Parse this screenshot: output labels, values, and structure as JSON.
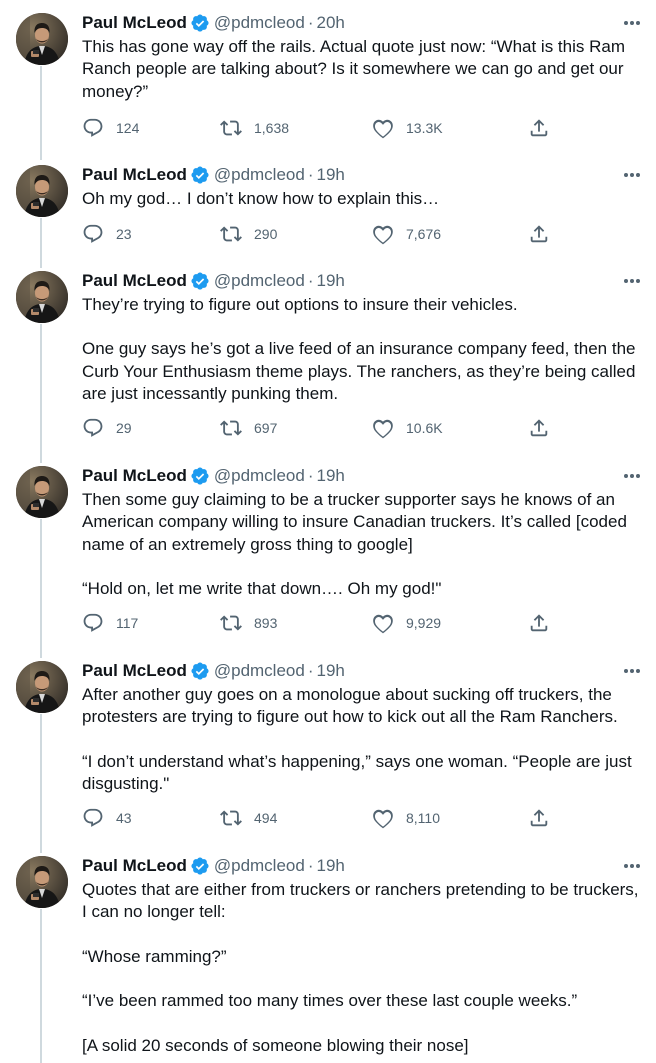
{
  "author": {
    "name": "Paul McLeod",
    "handle": "@pdmcleod",
    "verified": true
  },
  "colors": {
    "text": "#0f1419",
    "secondary": "#536471",
    "verified_badge": "#1d9bf0",
    "thread_line": "#cfd9de"
  },
  "icons": {
    "reply": "speech-bubble",
    "retweet": "two-arrows-loop",
    "like": "heart",
    "share": "upload-arrow",
    "more": "three-dots"
  },
  "tweets": [
    {
      "time": "20h",
      "paragraphs": [
        "This has gone way off the rails. Actual quote just now: “What is this Ram Ranch people are talking about? Is it somewhere we can go and get our money?”"
      ],
      "replies": "124",
      "retweets": "1,638",
      "likes": "13.3K"
    },
    {
      "time": "19h",
      "paragraphs": [
        "Oh my god… I don’t know how to explain this…"
      ],
      "replies": "23",
      "retweets": "290",
      "likes": "7,676"
    },
    {
      "time": "19h",
      "paragraphs": [
        "They’re trying to figure out options to insure their vehicles.",
        "One guy says he’s got a live feed of an insurance company feed, then the Curb Your Enthusiasm theme plays. The ranchers, as they’re being called are just incessantly punking them."
      ],
      "replies": "29",
      "retweets": "697",
      "likes": "10.6K"
    },
    {
      "time": "19h",
      "paragraphs": [
        "Then some guy claiming to be a trucker supporter says he knows of an American company willing to insure Canadian truckers. It’s called [coded name of an extremely gross thing to google]",
        "“Hold on, let me write that down…. Oh my god!\""
      ],
      "replies": "117",
      "retweets": "893",
      "likes": "9,929"
    },
    {
      "time": "19h",
      "paragraphs": [
        "After another guy goes on a monologue about sucking off truckers, the protesters are trying to figure out how to kick out all the Ram Ranchers.",
        "“I don’t understand what’s happening,” says one woman. “People are just disgusting.\""
      ],
      "replies": "43",
      "retweets": "494",
      "likes": "8,110"
    },
    {
      "time": "19h",
      "paragraphs": [
        "Quotes that are either from truckers or ranchers pretending to be truckers, I can no longer tell:",
        "“Whose ramming?”",
        "“I’ve been rammed too many times over these last couple weeks.”",
        "[A solid 20 seconds of someone blowing their nose]"
      ]
    }
  ]
}
